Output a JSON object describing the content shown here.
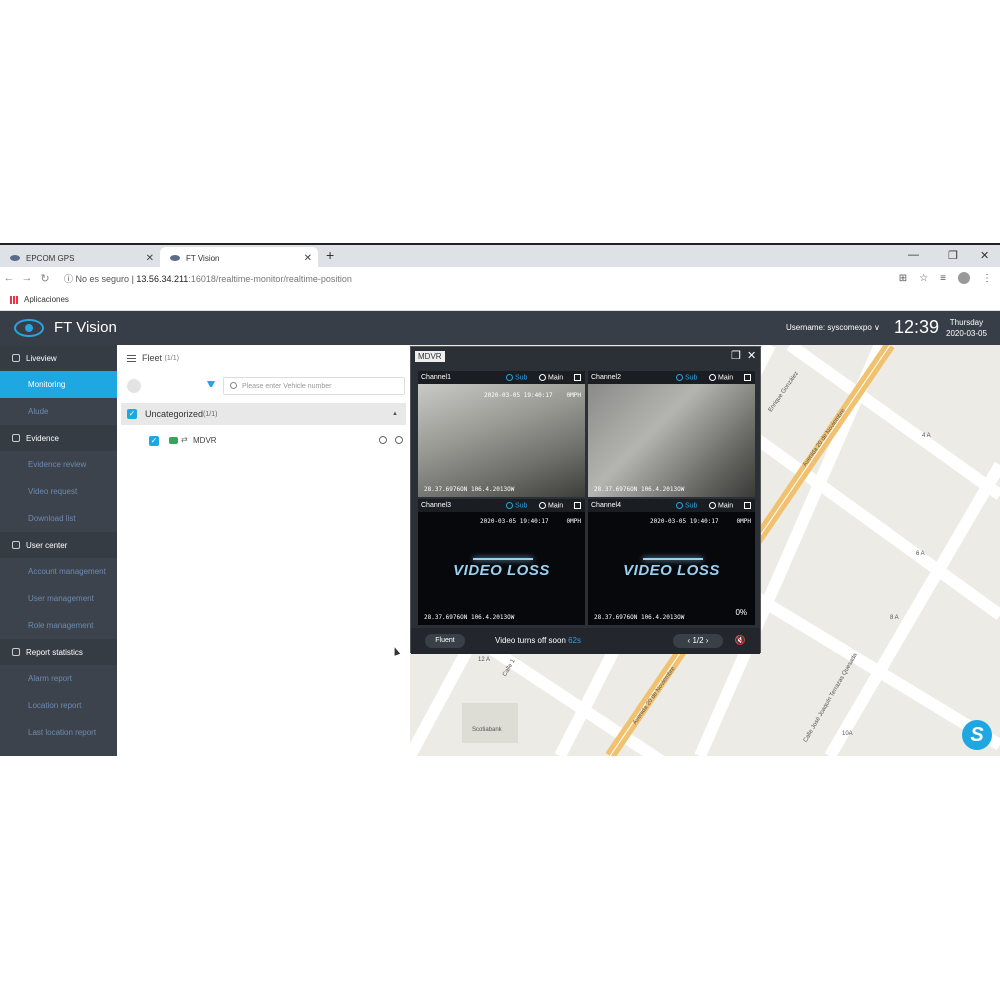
{
  "browser": {
    "tabs": [
      {
        "label": "EPCOM GPS",
        "active": false
      },
      {
        "label": "FT Vision",
        "active": true
      }
    ],
    "address": {
      "security": "No es seguro",
      "host": "13.56.34.211",
      "path": ":16018/realtime-monitor/realtime-position"
    },
    "bookmarks_label": "Aplicaciones"
  },
  "app": {
    "name": "FT Vision",
    "username_label": "Username: syscomexpo",
    "time": "12:39",
    "day": "Thursday",
    "date": "2020-03-05",
    "accent": "#1ea7e0"
  },
  "sidebar": {
    "sections": [
      {
        "label": "Liveview",
        "icon": "location-icon",
        "items": [
          "Monitoring",
          "Alude"
        ]
      },
      {
        "label": "Evidence",
        "icon": "evidence-icon",
        "items": [
          "Evidence review",
          "Video request",
          "Download list"
        ]
      },
      {
        "label": "User center",
        "icon": "user-icon",
        "items": [
          "Account management",
          "User management",
          "Role management"
        ]
      },
      {
        "label": "Report statistics",
        "icon": "chart-icon",
        "items": [
          "Alarm report",
          "Location report",
          "Last location report"
        ]
      }
    ],
    "active_item": "Monitoring"
  },
  "fleet": {
    "title": "Fleet",
    "count": "(1/1)",
    "search_placeholder": "Please enter Vehicle number",
    "group": {
      "label": "Uncategorized",
      "count": "(1/1)"
    },
    "vehicle": {
      "label": "MDVR"
    }
  },
  "video": {
    "title": "MDVR",
    "channels": [
      {
        "name": "Channel1",
        "sub": "Sub",
        "main": "Main",
        "timestamp": "2020-03-05 19:40:17",
        "coords": "28.37.6976ON 106.4.2013OW",
        "speed": "0MPH",
        "loss": false
      },
      {
        "name": "Channel2",
        "sub": "Sub",
        "main": "Main",
        "timestamp": "",
        "coords": "28.37.6976ON 106.4.2013OW",
        "speed": "",
        "loss": false
      },
      {
        "name": "Channel3",
        "sub": "Sub",
        "main": "Main",
        "timestamp": "2020-03-05 19:40:17",
        "coords": "28.37.6976ON 106.4.2013OW",
        "speed": "0MPH",
        "loss": true,
        "loss_text": "VIDEO LOSS"
      },
      {
        "name": "Channel4",
        "sub": "Sub",
        "main": "Main",
        "timestamp": "2020-03-05 19:40:17",
        "coords": "28.37.6976ON 106.4.2013OW",
        "speed": "0MPH",
        "loss": true,
        "loss_text": "VIDEO LOSS",
        "percent": "0%"
      }
    ],
    "footer": {
      "quality": "Fluent",
      "turnoff_text": "Video turns off soon",
      "turnoff_secs": "62s",
      "page": "1/2"
    }
  },
  "map": {
    "labels": [
      "Enrique González",
      "Avenida 20 de Noviembre",
      "4 A",
      "6 A",
      "8 A",
      "12 A",
      "Calle 1",
      "Avenida 20 de Noviembre",
      "Calle José Joaquín Terrazas Quesada",
      "10A",
      "Scotiabank"
    ]
  }
}
